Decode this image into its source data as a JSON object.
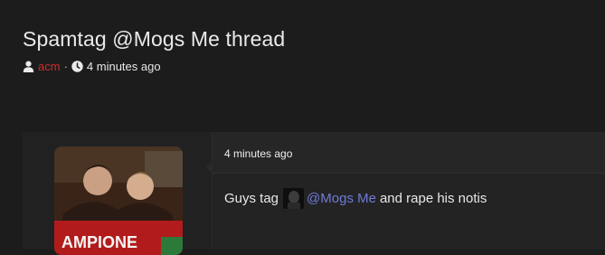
{
  "thread": {
    "title": "Spamtag @Mogs Me thread",
    "author": "acm",
    "separator": "·",
    "posted_ago": "4 minutes ago"
  },
  "post": {
    "time": "4 minutes ago",
    "text_before": "Guys tag",
    "mention": "@Mogs Me",
    "text_after": "and rape his notis"
  },
  "colors": {
    "background": "#1c1c1c",
    "author": "#d12c2c",
    "mention": "#6f7bd8"
  },
  "icons": [
    "user-icon",
    "clock-icon"
  ]
}
